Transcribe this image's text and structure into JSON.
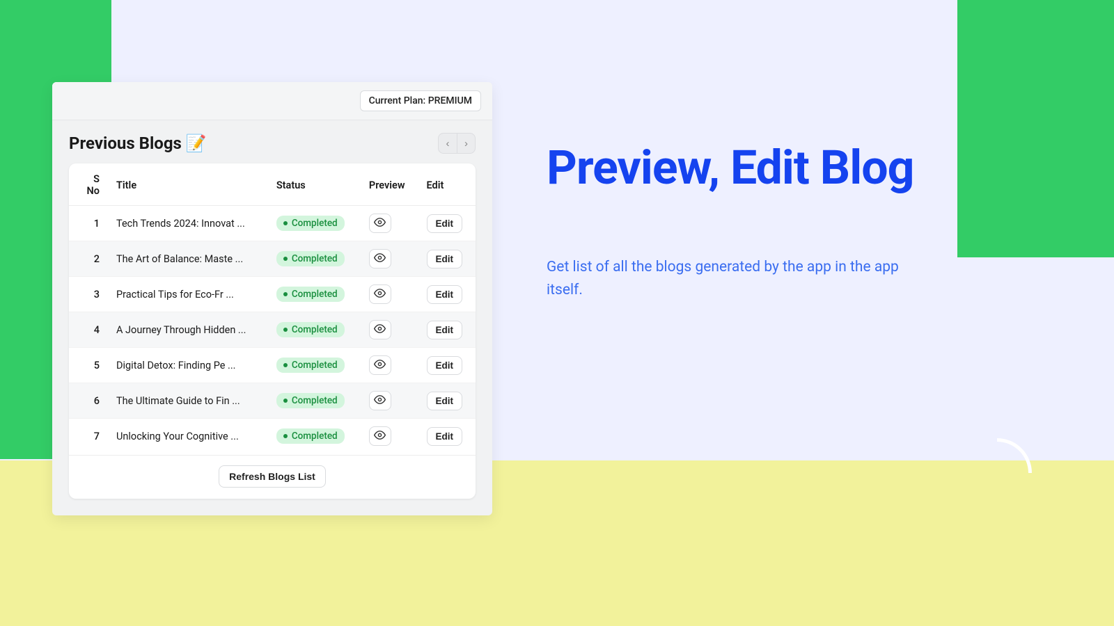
{
  "plan": {
    "label": "Current Plan: PREMIUM"
  },
  "section": {
    "title": "Previous Blogs",
    "emoji": "📝"
  },
  "table": {
    "headers": {
      "sno": "S No",
      "title": "Title",
      "status": "Status",
      "preview": "Preview",
      "edit": "Edit"
    },
    "rows": [
      {
        "sno": "1",
        "title": "Tech Trends 2024: Innovat ...",
        "status": "Completed"
      },
      {
        "sno": "2",
        "title": "The Art of Balance: Maste ...",
        "status": "Completed"
      },
      {
        "sno": "3",
        "title": "Practical Tips for Eco-Fr ...",
        "status": "Completed"
      },
      {
        "sno": "4",
        "title": "A Journey Through Hidden ...",
        "status": "Completed"
      },
      {
        "sno": "5",
        "title": "Digital Detox: Finding Pe ...",
        "status": "Completed"
      },
      {
        "sno": "6",
        "title": "The Ultimate Guide to Fin ...",
        "status": "Completed"
      },
      {
        "sno": "7",
        "title": "Unlocking Your Cognitive ...",
        "status": "Completed"
      }
    ],
    "edit_label": "Edit",
    "refresh_label": "Refresh Blogs List"
  },
  "hero": {
    "title": "Preview, Edit Blog",
    "subtitle": "Get list of all the blogs generated by the app in the app itself."
  }
}
